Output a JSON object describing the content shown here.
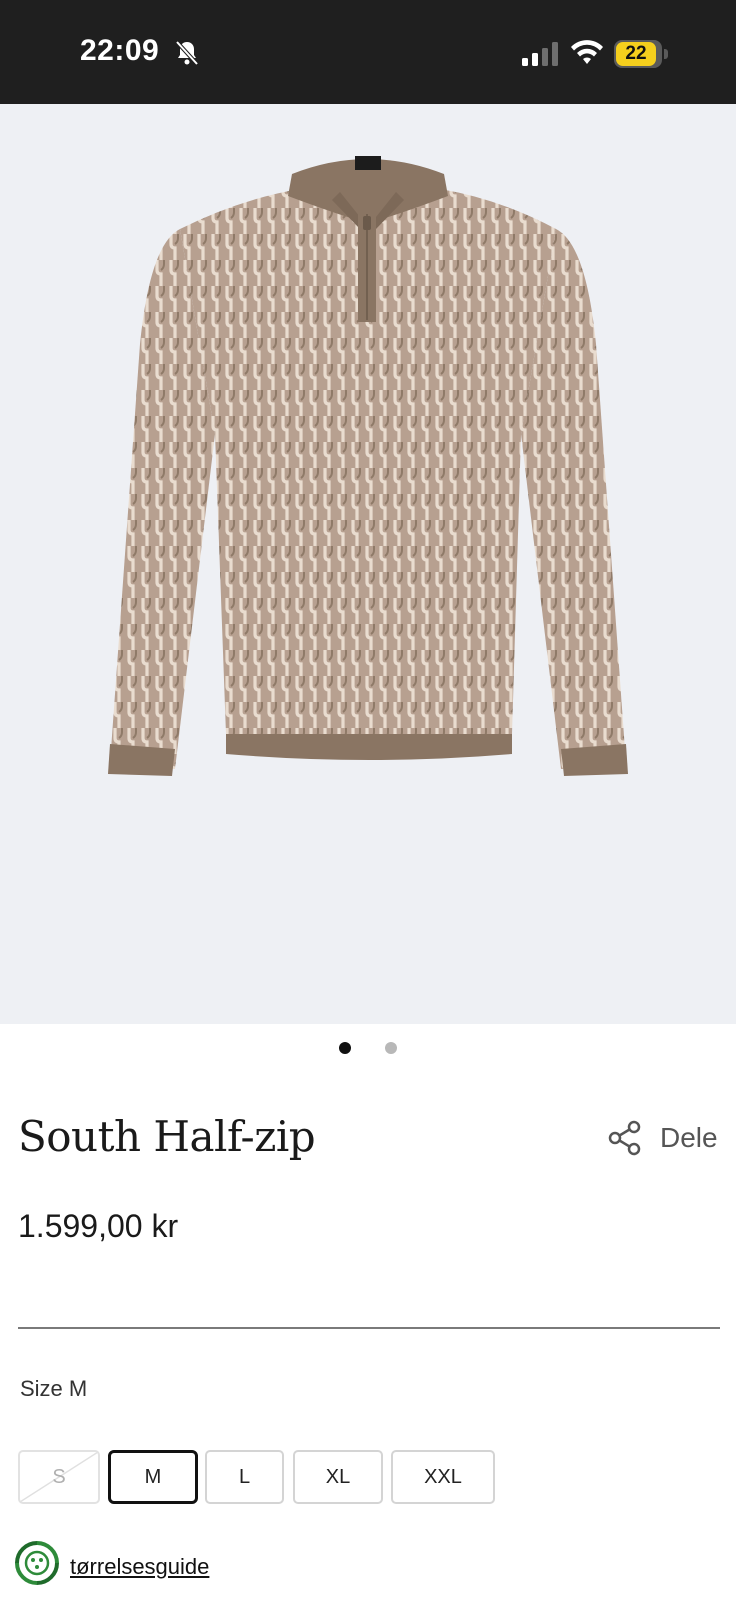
{
  "status_bar": {
    "time": "22:09",
    "battery": "22",
    "battery_color": "#f5cf1d"
  },
  "product": {
    "image_alt": "Half-zip knitted sweater in taupe with cable pattern",
    "title": "South Half-zip",
    "share_label": "Dele",
    "price": "1.599,00 kr",
    "image_count": 2,
    "active_image_index": 0
  },
  "size": {
    "label": "Size M",
    "options": [
      "S",
      "M",
      "L",
      "XL",
      "XXL"
    ],
    "selected": "M",
    "unavailable": [
      "S"
    ]
  },
  "size_guide": {
    "label": "tørrelsesguide"
  },
  "colors": {
    "sweater_body": "#b29b8a",
    "sweater_trim": "#8a7563",
    "image_bg": "#eef0f4",
    "guide_icon_green": "#2e8b3a"
  }
}
